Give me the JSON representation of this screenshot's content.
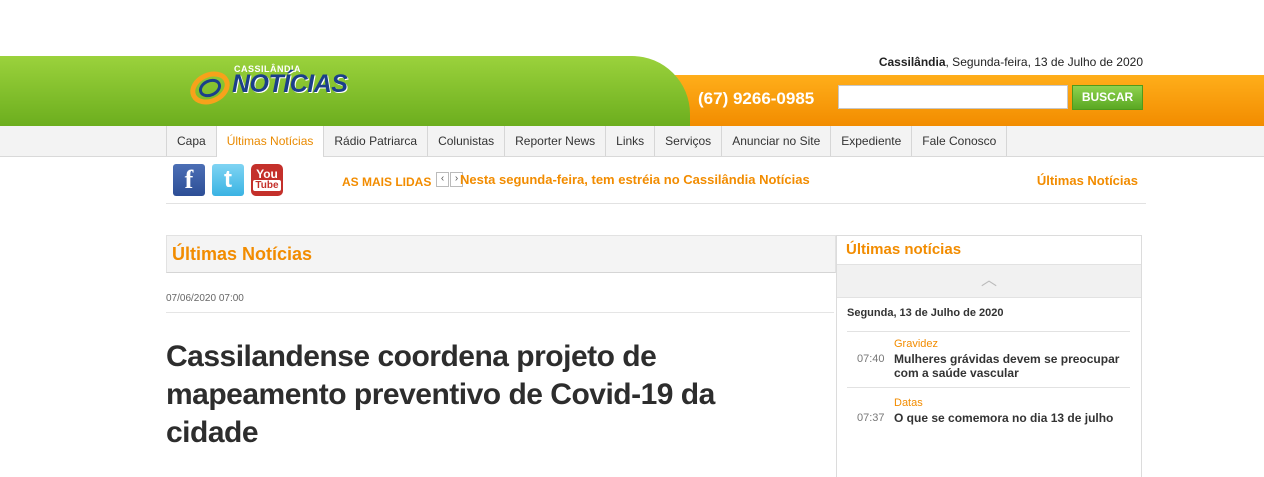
{
  "header": {
    "city": "Cassilândia",
    "date_rest": ", Segunda-feira, 13 de Julho de 2020",
    "logo_small": "CASSILÂNDIA",
    "logo_big": "NOTÍCIAS",
    "phone": "(67) 9266-0985",
    "search_placeholder": "",
    "search_button": "BUSCAR",
    "colors": {
      "green": "#7cbf2a",
      "orange": "#f7990d",
      "logo_blue": "#1b3f8a"
    }
  },
  "nav": {
    "items": [
      {
        "label": "Capa"
      },
      {
        "label": "Últimas Notícias"
      },
      {
        "label": "Rádio Patriarca"
      },
      {
        "label": "Colunistas"
      },
      {
        "label": "Reporter News"
      },
      {
        "label": "Links"
      },
      {
        "label": "Serviços"
      },
      {
        "label": "Anunciar no Site"
      },
      {
        "label": "Expediente"
      },
      {
        "label": "Fale Conosco"
      }
    ],
    "active": "Últimas Notícias"
  },
  "social": {
    "facebook_icon": "facebook-icon",
    "twitter_icon": "twitter-icon",
    "youtube_you": "You",
    "youtube_tube": "Tube"
  },
  "ticker": {
    "label": "AS MAIS LIDAS",
    "headline": "Nesta segunda-feira, tem estréia no Cassilândia Notícias",
    "latest_link": "Últimas Notícias"
  },
  "main": {
    "section_title": "Últimas Notícias",
    "published": "07/06/2020 07:00",
    "article_title": "Cassilandense coordena projeto de mapeamento preventivo de Covid-19 da cidade"
  },
  "sidebar": {
    "title": "Últimas notícias",
    "day": "Segunda, 13 de Julho de 2020",
    "items": [
      {
        "category": "Gravidez",
        "time": "07:40",
        "text": "Mulheres grávidas devem se preocupar com a saúde vascular"
      },
      {
        "category": "Datas",
        "time": "07:37",
        "text": "O que se comemora no dia 13 de julho"
      }
    ]
  }
}
